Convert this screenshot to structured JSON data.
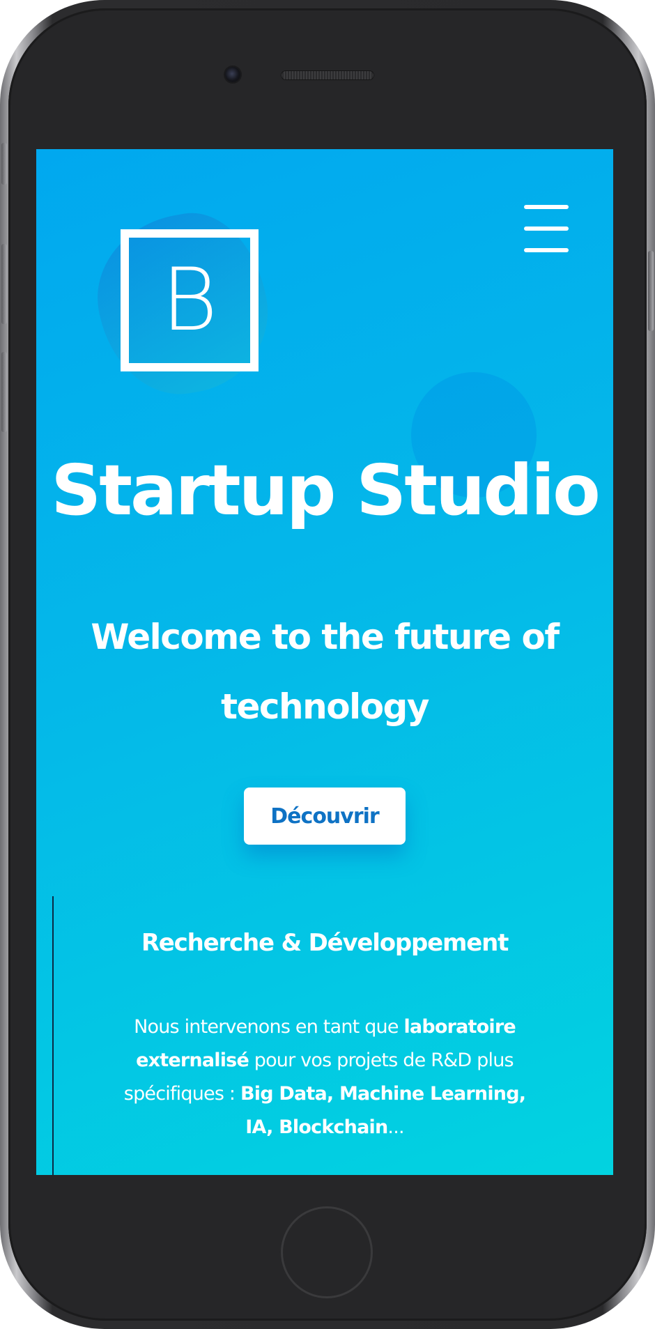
{
  "brand": {
    "logo_letter": "B"
  },
  "menu": {
    "icon": "hamburger-menu-icon"
  },
  "hero": {
    "title": "Startup Studio",
    "subtitle": "Welcome to the future of technology",
    "cta_label": "Découvrir"
  },
  "section": {
    "title": "Recherche & Développement",
    "text_part1": "Nous intervenons en tant que ",
    "text_bold1": "laboratoire externalisé",
    "text_part2": " pour vos projets de R&D plus spécifiques : ",
    "text_bold2": "Big Data, Machine Learning, IA, Blockchain",
    "text_part3": "..."
  },
  "colors": {
    "gradient_start": "#01a8ef",
    "gradient_end": "#02d3e0",
    "button_text": "#0e72c4",
    "device_frame": "#262628"
  }
}
